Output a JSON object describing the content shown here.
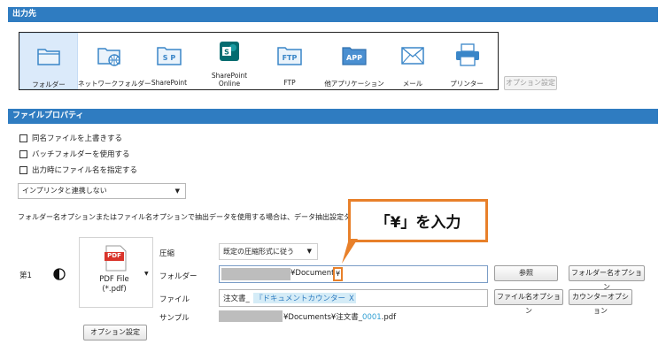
{
  "output_section": {
    "title": "出力先",
    "items": [
      {
        "label": "フォルダー"
      },
      {
        "label": "ネットワークフォルダー"
      },
      {
        "label": "SharePoint"
      },
      {
        "label": "SharePoint Online"
      },
      {
        "label": "FTP"
      },
      {
        "label": "他アプリケーション"
      },
      {
        "label": "メール"
      },
      {
        "label": "プリンター"
      }
    ],
    "icon_texts": {
      "sharepoint": "S P",
      "ftp": "FTP",
      "app": "APP"
    },
    "option_button": "オプション設定"
  },
  "file_property": {
    "title": "ファイルプロパティ",
    "checkboxes": [
      "同名ファイルを上書きする",
      "バッチフォルダーを使用する",
      "出力時にファイル名を指定する"
    ],
    "printer_select": "インプリンタと連携しない",
    "note": "フォルダー名オプションまたはファイル名オプションで抽出データを使用する場合は、データ抽出設定タブでフィ"
  },
  "callout": {
    "text": "「¥」を入力",
    "color": "#e8802a"
  },
  "row": {
    "label": "第1",
    "file_format": "PDF File\n(*.pdf)",
    "pdf_icon_text": "PDF",
    "option_button": "オプション設定",
    "compression_label": "圧縮",
    "compression_value": "既定の圧縮形式に従う",
    "folder_label": "フォルダー",
    "folder_value": "¥Document",
    "folder_highlight": "¥",
    "file_label": "ファイル",
    "file_prefix": "注文書_",
    "file_token": "『ドキュメントカウンター",
    "file_token_close": "X",
    "sample_label": "サンプル",
    "sample_text_1": "¥Documents¥注文書_",
    "sample_counter": "0001",
    "sample_text_2": ".pdf",
    "browse_button": "参照",
    "folder_option_button": "フォルダー名オプション",
    "file_option_button": "ファイル名オプション",
    "counter_option_button": "カウンターオプション"
  }
}
